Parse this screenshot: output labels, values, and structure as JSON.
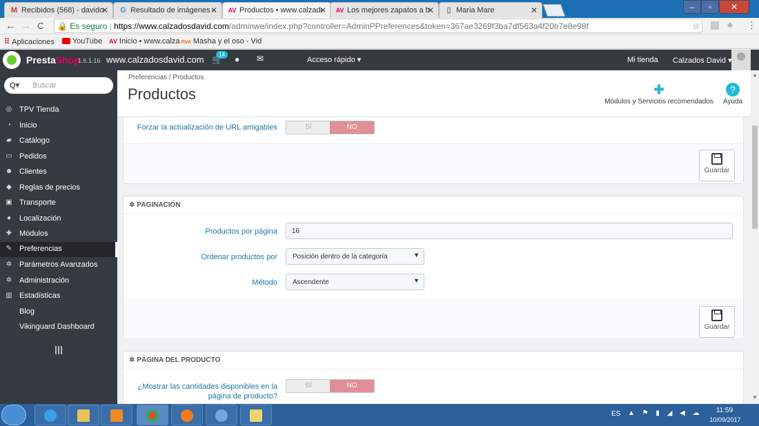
{
  "browser": {
    "tabs": [
      {
        "label": "Recibidos (568) - davido",
        "icon": "M",
        "icon_color": "#d93025",
        "active": false
      },
      {
        "label": "Resultado de imágenes d",
        "icon": "G",
        "icon_color": "#4285f4",
        "active": false
      },
      {
        "label": "Productos • www.calzado",
        "icon": "AV",
        "icon_color": "#df0067",
        "active": true
      },
      {
        "label": "Los mejores zapatos a bu",
        "icon": "AV",
        "icon_color": "#df0067",
        "active": false
      },
      {
        "label": "Maria Mare",
        "icon": "▯",
        "icon_color": "#777777",
        "active": false
      }
    ],
    "close_glyph": "✕",
    "window_controls": [
      "–",
      "▫",
      "✕"
    ],
    "nav": {
      "back": "←",
      "forward": "→",
      "reload": "C"
    },
    "address": {
      "secure_label": "Es seguro",
      "host": "https://www.calzadosdavid.com",
      "path": "/adminwe/index.php?controller=AdminPPreferences&token=367ae3269f3ba7df563a4f20b7e8e98f"
    },
    "bookmarks": [
      {
        "label": "Aplicaciones",
        "icon": "grid-icon"
      },
      {
        "label": "YouTube",
        "icon": "youtube-icon"
      },
      {
        "label": "Inicio • www.calzados",
        "icon": "av-icon"
      },
      {
        "label": "Masha y el oso - Vid",
        "icon": "rtve-icon"
      }
    ]
  },
  "header": {
    "brand_a": "Presta",
    "brand_b": "Shop",
    "version": "1.6.1.16",
    "shop_url": "www.calzadosdavid.com",
    "cart_count": "14",
    "quick_access": "Acceso rápido ▾",
    "my_store": "Mi tienda",
    "employee": "Calzados David ▾"
  },
  "sidebar": {
    "search_placeholder": "Buscar",
    "items": [
      {
        "label": "TPV Tienda",
        "icon": "target-icon",
        "glyph": "◎",
        "active": false
      },
      {
        "label": "Inicio",
        "icon": "dashboard-icon",
        "glyph": "◔",
        "active": false
      },
      {
        "label": "Catálogo",
        "icon": "book-icon",
        "glyph": "▰",
        "active": false
      },
      {
        "label": "Pedidos",
        "icon": "credit-card-icon",
        "glyph": "▭",
        "active": false
      },
      {
        "label": "Clientes",
        "icon": "users-icon",
        "glyph": "☻",
        "active": false
      },
      {
        "label": "Reglas de precios",
        "icon": "tag-icon",
        "glyph": "◆",
        "active": false
      },
      {
        "label": "Transporte",
        "icon": "truck-icon",
        "glyph": "▣",
        "active": false
      },
      {
        "label": "Localización",
        "icon": "globe-icon",
        "glyph": "●",
        "active": false
      },
      {
        "label": "Módulos",
        "icon": "puzzle-icon",
        "glyph": "✚",
        "active": false
      },
      {
        "label": "Preferencias",
        "icon": "wrench-icon",
        "glyph": "✎",
        "active": true
      },
      {
        "label": "Parámetros Avanzados",
        "icon": "gears-icon",
        "glyph": "✲",
        "active": false
      },
      {
        "label": "Administración",
        "icon": "gear-icon",
        "glyph": "✲",
        "active": false
      },
      {
        "label": "Estadísticas",
        "icon": "bar-chart-icon",
        "glyph": "▥",
        "active": false
      },
      {
        "label": "Blog",
        "icon": "",
        "glyph": "",
        "active": false
      },
      {
        "label": "Vikinguard Dashboard",
        "icon": "",
        "glyph": "",
        "active": false
      }
    ]
  },
  "page": {
    "breadcrumb": "Preferencias  /  Productos",
    "title": "Productos",
    "modules_label": "Módulos y Servicios recomendados",
    "help_label": "Ayuda"
  },
  "panel1": {
    "field_label": "Forzar la actualización de URL amigables",
    "switch_yes": "SÍ",
    "switch_no": "NO",
    "selected": "NO",
    "save_label": "Guardar"
  },
  "panel2": {
    "heading": "PAGINACIÓN",
    "products_per_page_label": "Productos por página",
    "products_per_page_value": "16",
    "order_by_label": "Ordenar productos por",
    "order_by_value": "Posición dentro de la categoría",
    "method_label": "Método",
    "method_value": "Ascendente",
    "save_label": "Guardar"
  },
  "panel3": {
    "heading": "PÁGINA DEL PRODUCTO",
    "show_qty_label_1": "¿Mostrar las cantidades disponibles en la",
    "show_qty_label_2": "página de producto?",
    "switch_yes": "SÍ",
    "switch_no": "NO",
    "selected": "NO"
  },
  "taskbar": {
    "lang": "ES",
    "time": "11:59",
    "date": "10/09/2017"
  },
  "colors": {
    "accent": "#25b9d7",
    "brand_pink": "#df0067",
    "switch_no": "#e08f95",
    "sidebar_bg": "#363a41"
  }
}
